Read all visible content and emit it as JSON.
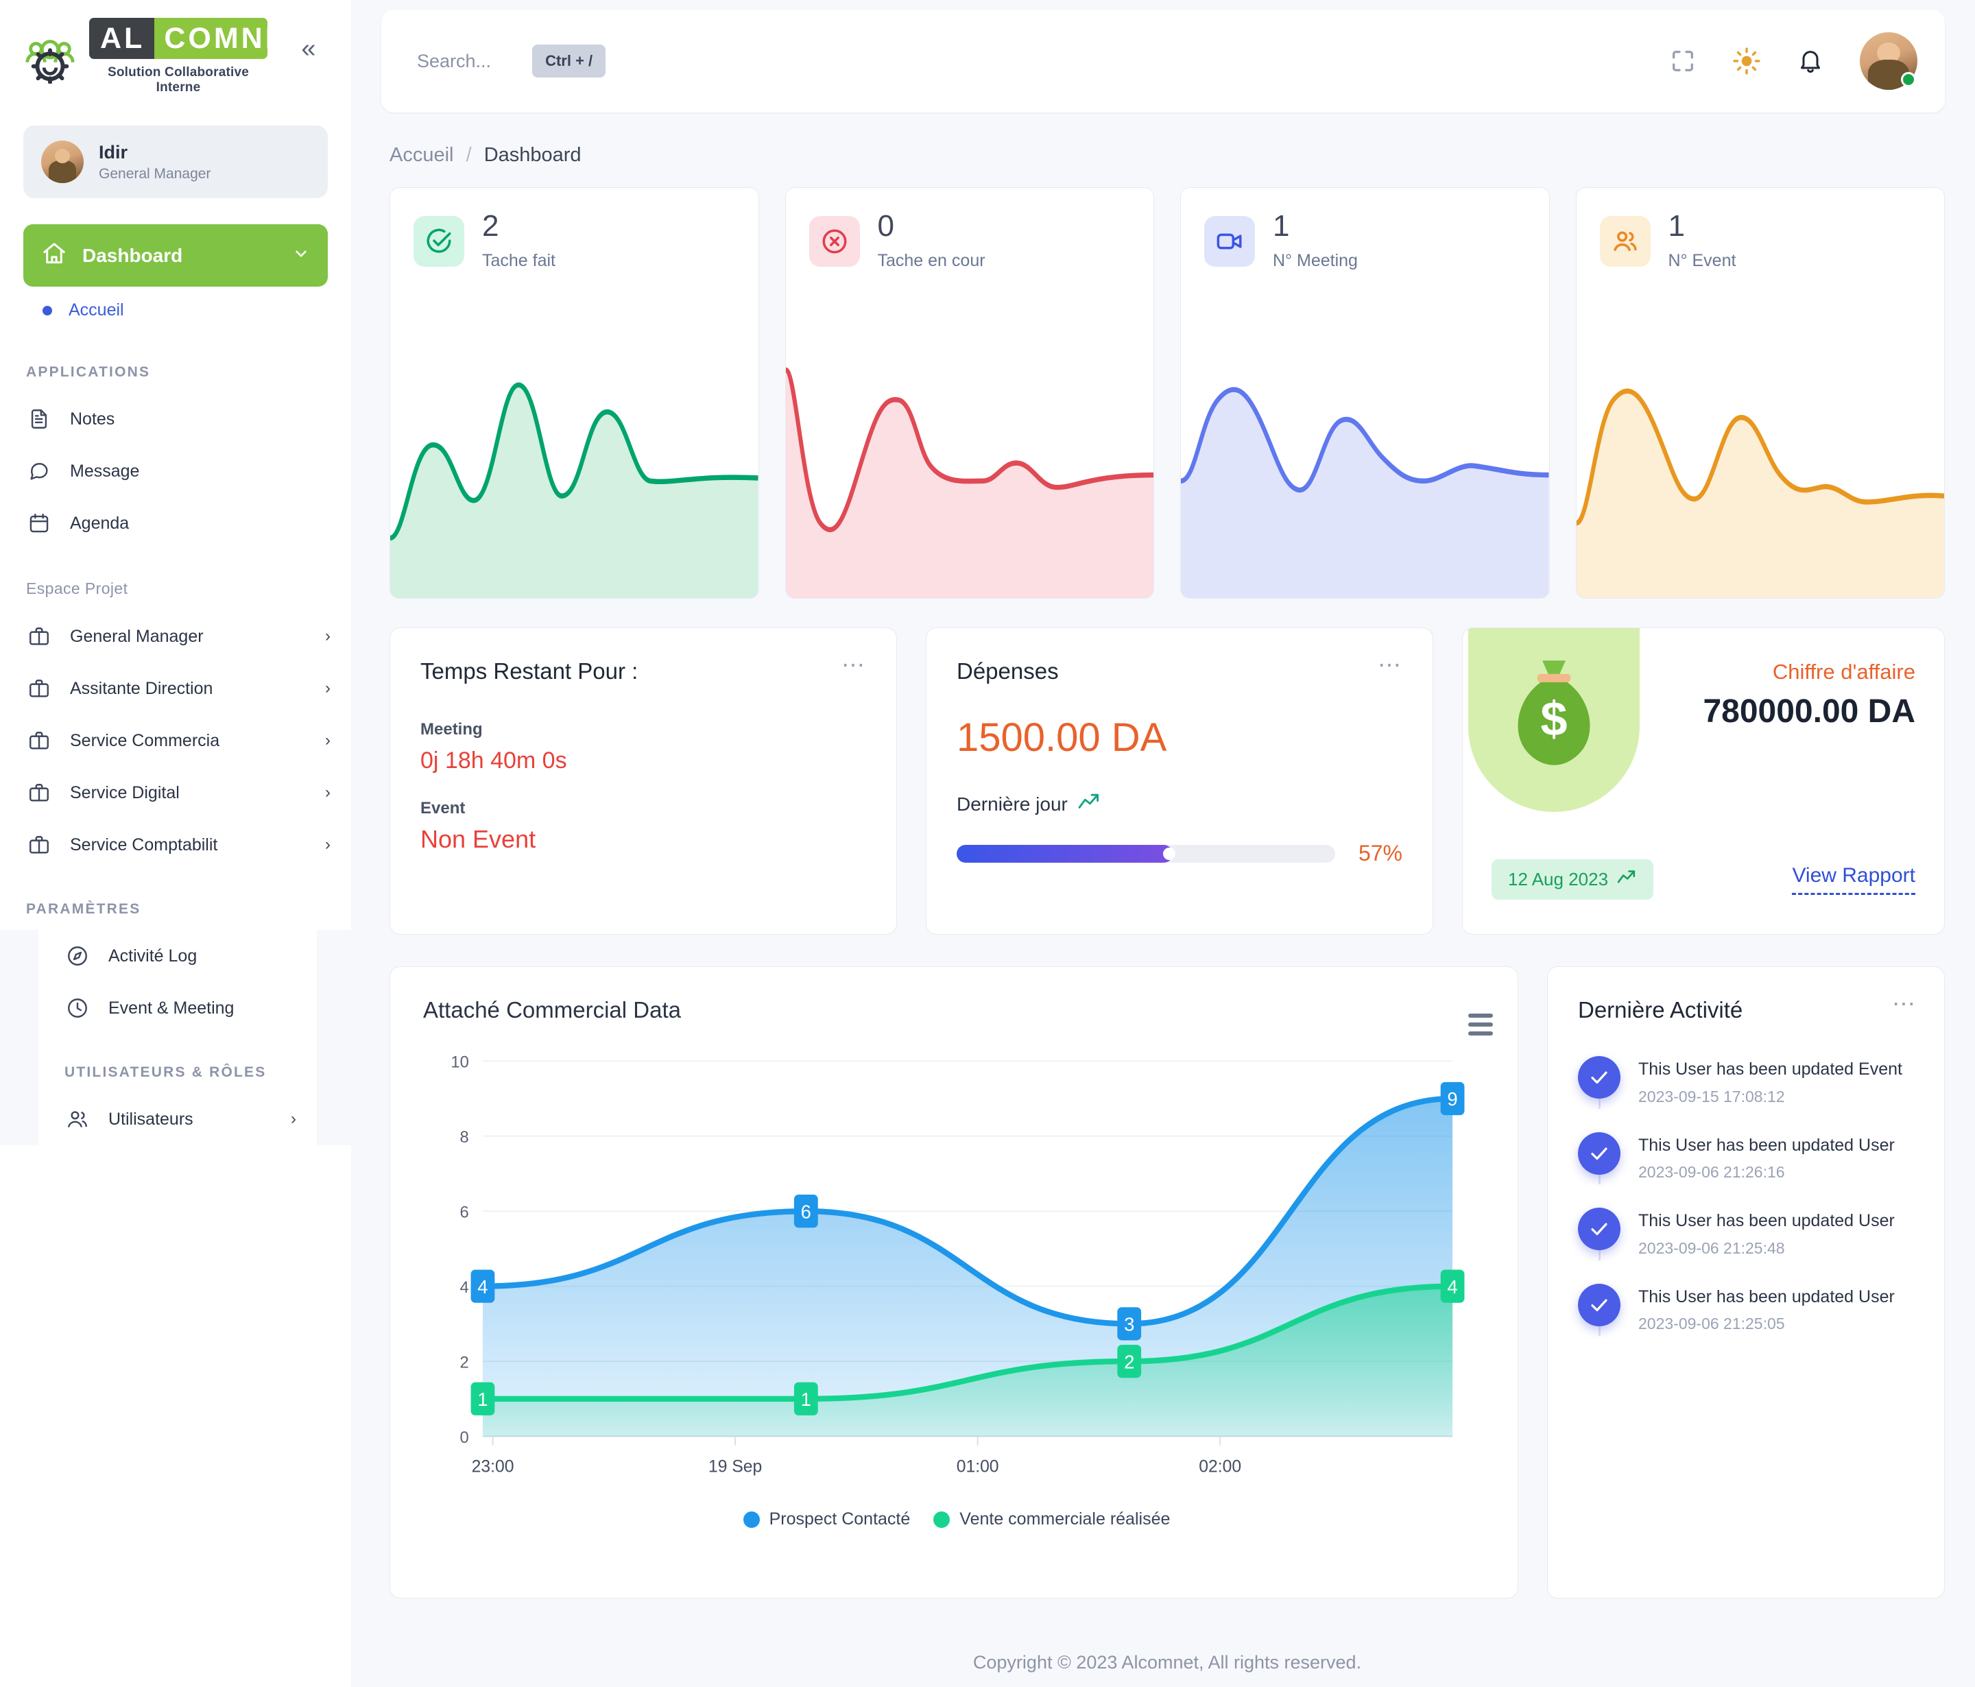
{
  "brand": {
    "logo_first": "AL",
    "logo_second": "COMNET",
    "tagline": "Solution Collaborative Interne",
    "collapse_icon": "chevrons-left-icon"
  },
  "profile": {
    "name": "Idir",
    "role": "General Manager"
  },
  "sidebar": {
    "active_item": {
      "label": "Dashboard",
      "icon": "home-icon",
      "chevron": "chevron-down-icon"
    },
    "sub_items": [
      {
        "label": "Accueil"
      }
    ],
    "sections": [
      {
        "title": "APPLICATIONS",
        "items": [
          {
            "label": "Notes",
            "icon": "file-text-icon",
            "chevron": ""
          },
          {
            "label": "Message",
            "icon": "chat-bubble-icon",
            "chevron": ""
          },
          {
            "label": "Agenda",
            "icon": "calendar-icon",
            "chevron": ""
          }
        ]
      },
      {
        "title": "Espace Projet",
        "items": [
          {
            "label": "General Manager",
            "icon": "briefcase-icon",
            "chevron": "›"
          },
          {
            "label": "Assitante Direction",
            "icon": "briefcase-icon",
            "chevron": "›"
          },
          {
            "label": "Service Commercia",
            "icon": "briefcase-icon",
            "chevron": "›"
          },
          {
            "label": "Service Digital",
            "icon": "briefcase-icon",
            "chevron": "›"
          },
          {
            "label": "Service Comptabilit",
            "icon": "briefcase-icon",
            "chevron": "›"
          }
        ]
      },
      {
        "title": "PARAMÈTRES",
        "items": [
          {
            "label": "Activité Log",
            "icon": "compass-icon",
            "chevron": ""
          },
          {
            "label": "Event & Meeting",
            "icon": "clock-icon",
            "chevron": ""
          }
        ]
      },
      {
        "title": "UTILISATEURS & RÔLES",
        "items": [
          {
            "label": "Utilisateurs",
            "icon": "users-icon",
            "chevron": "›"
          }
        ]
      }
    ]
  },
  "topbar": {
    "search_placeholder": "Search...",
    "shortcut": "Ctrl + /",
    "icons": [
      "fullscreen-icon",
      "sun-icon",
      "bell-icon"
    ],
    "avatar": "user-avatar"
  },
  "breadcrumb": {
    "parent": "Accueil",
    "separator": "/",
    "current": "Dashboard"
  },
  "stats": [
    {
      "value": "2",
      "label": "Tache fait",
      "icon": "check-circle-icon",
      "color": "#00a46c",
      "bg": "#d3f5e6"
    },
    {
      "value": "0",
      "label": "Tache en cour",
      "icon": "x-circle-icon",
      "color": "#e23e4e",
      "bg": "#fbdfe3"
    },
    {
      "value": "1",
      "label": "N° Meeting",
      "icon": "video-camera-icon",
      "color": "#3a56e8",
      "bg": "#dfe4fb"
    },
    {
      "value": "1",
      "label": "N° Event",
      "icon": "users-icon",
      "color": "#e88a22",
      "bg": "#fdeed6"
    }
  ],
  "temps_restant": {
    "title": "Temps Restant Pour :",
    "meeting_label": "Meeting",
    "meeting_value": "0j 18h 40m 0s",
    "event_label": "Event",
    "event_value": "Non Event"
  },
  "depenses": {
    "title": "Dépenses",
    "amount": "1500.00 DA",
    "subtitle": "Dernière jour",
    "trend_icon": "trend-up-icon",
    "percent_label": "57%",
    "percent_value": 57
  },
  "chiffre": {
    "title": "Chiffre d'affaire",
    "amount": "780000.00 DA",
    "date": "12 Aug 2023",
    "trend_icon": "trend-up-icon",
    "link": "View Rapport",
    "bag_icon": "money-bag-icon"
  },
  "chart_card": {
    "title": "Attaché Commercial Data",
    "menu_icon": "hamburger-menu-icon"
  },
  "chart_data": {
    "type": "area",
    "title": "Attaché Commercial Data",
    "xlabel": "",
    "ylabel": "",
    "x": [
      "23:00",
      "19 Sep",
      "01:00",
      "02:00"
    ],
    "tick_labels": [
      "23:00",
      "19 Sep",
      "01:00",
      "02:00"
    ],
    "ylim": [
      0,
      10
    ],
    "yticks": [
      0,
      2,
      4,
      6,
      8,
      10
    ],
    "grid": true,
    "legend_position": "bottom",
    "series": [
      {
        "name": "Prospect Contacté",
        "color": "#1e96ea",
        "values": [
          4,
          6,
          3,
          9
        ]
      },
      {
        "name": "Vente commerciale réalisée",
        "color": "#16d48f",
        "values": [
          1,
          1,
          2,
          4
        ]
      }
    ]
  },
  "activity": {
    "title": "Dernière Activité",
    "menu_icon": "ellipsis-icon",
    "items": [
      {
        "text": "This User has been updated Event",
        "time": "2023-09-15 17:08:12",
        "icon": "check-icon"
      },
      {
        "text": "This User has been updated User",
        "time": "2023-09-06 21:26:16",
        "icon": "check-icon"
      },
      {
        "text": "This User has been updated User",
        "time": "2023-09-06 21:25:48",
        "icon": "check-icon"
      },
      {
        "text": "This User has been updated User",
        "time": "2023-09-06 21:25:05",
        "icon": "check-icon"
      }
    ]
  },
  "footer": {
    "text": "Copyright © 2023 Alcomnet, All rights reserved."
  }
}
